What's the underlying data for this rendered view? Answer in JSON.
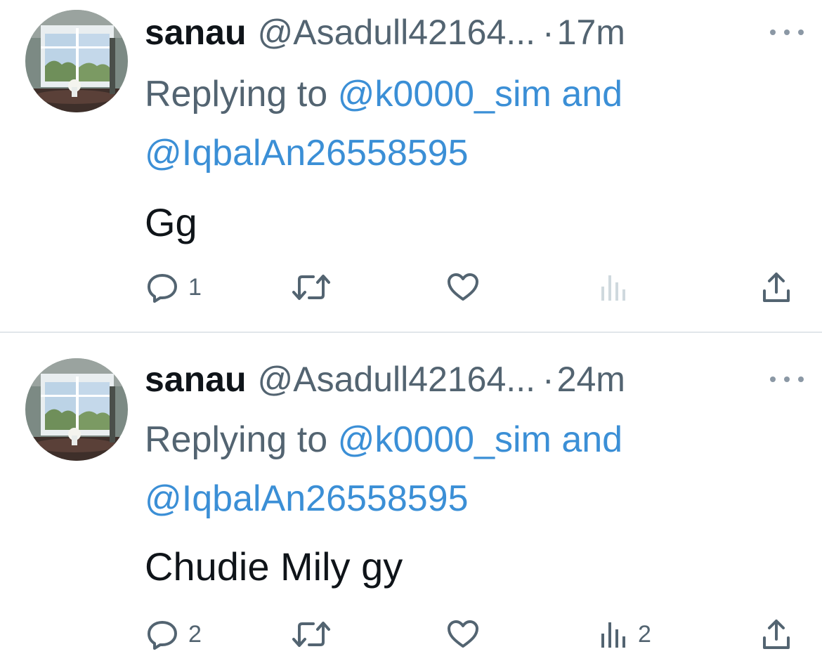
{
  "tweets": [
    {
      "display_name": "sanau",
      "handle": "@Asadull42164...",
      "separator": "·",
      "time": "17m",
      "replying_prefix": "Replying to ",
      "mention_1": "@k0000_sim",
      "conjunction": " and",
      "mention_2": "@IqbalAn26558595",
      "text": "Gg",
      "reply_count": "1",
      "views_count": ""
    },
    {
      "display_name": "sanau",
      "handle": "@Asadull42164...",
      "separator": "·",
      "time": "24m",
      "replying_prefix": "Replying to ",
      "mention_1": "@k0000_sim",
      "conjunction": " and",
      "mention_2": "@IqbalAn26558595",
      "text": "Chudie Mily gy",
      "reply_count": "2",
      "views_count": "2"
    }
  ],
  "colors": {
    "mention_blue": "#3b8fd6",
    "secondary_gray": "#536471",
    "icon_gray": "#536471",
    "views_faded": "#cfd9de"
  },
  "icons": [
    "reply-icon",
    "retweet-icon",
    "like-icon",
    "views-icon",
    "share-icon",
    "more-options-icon"
  ]
}
